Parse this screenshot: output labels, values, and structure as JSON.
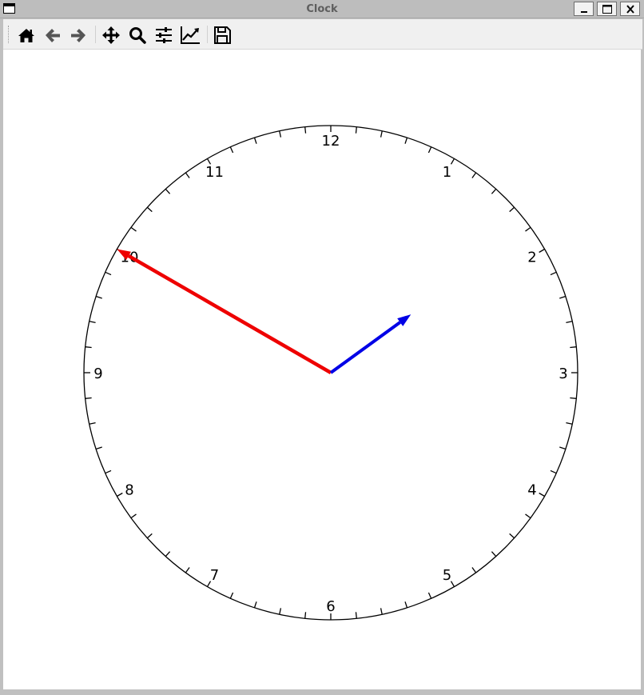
{
  "window": {
    "title": "Clock"
  },
  "toolbar": {
    "items": [
      {
        "name": "home-icon"
      },
      {
        "name": "back-icon"
      },
      {
        "name": "forward-icon"
      },
      {
        "name": "pan-icon"
      },
      {
        "name": "zoom-icon"
      },
      {
        "name": "configure-subplots-icon"
      },
      {
        "name": "edit-axis-icon"
      },
      {
        "name": "save-icon"
      }
    ]
  },
  "clock": {
    "hour_labels": [
      "12",
      "1",
      "2",
      "3",
      "4",
      "5",
      "6",
      "7",
      "8",
      "9",
      "10",
      "11"
    ],
    "hour_hand": {
      "color": "#0000e6",
      "angle_deg_from_12": 54
    },
    "minute_hand": {
      "color": "#ee0000",
      "angle_deg_from_12": 300
    },
    "tick_count": 60
  }
}
